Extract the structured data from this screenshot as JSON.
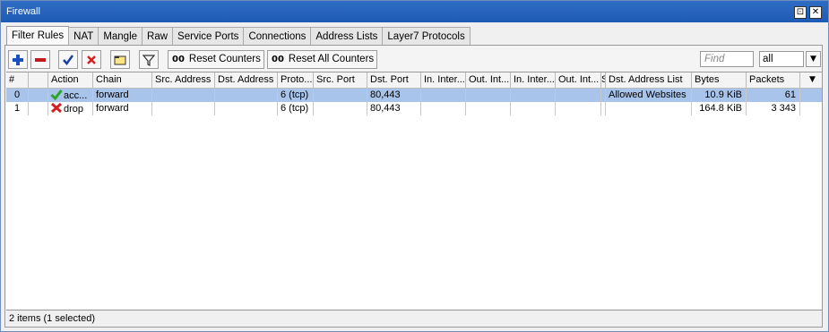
{
  "window": {
    "title": "Firewall",
    "restore_glyph": "⊡",
    "close_glyph": "✕"
  },
  "tabs": [
    {
      "label": "Filter Rules",
      "active": true
    },
    {
      "label": "NAT"
    },
    {
      "label": "Mangle"
    },
    {
      "label": "Raw"
    },
    {
      "label": "Service Ports"
    },
    {
      "label": "Connections"
    },
    {
      "label": "Address Lists"
    },
    {
      "label": "Layer7 Protocols"
    }
  ],
  "toolbar": {
    "add_icon": "plus-icon",
    "remove_icon": "minus-icon",
    "enable_icon": "check-icon",
    "disable_icon": "x-icon",
    "comment_icon": "note-icon",
    "filter_icon": "funnel-icon",
    "counter_prefix": "00",
    "reset_counters": "Reset Counters",
    "reset_all_counters": "Reset All Counters",
    "find_placeholder": "Find",
    "filter_value": "all"
  },
  "columns": [
    "#",
    "",
    "Action",
    "Chain",
    "Src. Address",
    "Dst. Address",
    "Proto...",
    "Src. Port",
    "Dst. Port",
    "In. Inter...",
    "Out. Int...",
    "In. Inter...",
    "Out. Int...",
    "S",
    "Dst. Address List",
    "Bytes",
    "Packets"
  ],
  "rows": [
    {
      "num": "0",
      "action": "acc...",
      "action_icon": "check-icon",
      "chain": "forward",
      "proto": "6 (tcp)",
      "dst_port": "80,443",
      "dst_addr_list": "Allowed Websites",
      "bytes": "10.9 KiB",
      "packets": "61",
      "selected": true
    },
    {
      "num": "1",
      "action": "drop",
      "action_icon": "x-icon",
      "chain": "forward",
      "proto": "6 (tcp)",
      "dst_port": "80,443",
      "dst_addr_list": "",
      "bytes": "164.8 KiB",
      "packets": "3 343",
      "selected": false
    }
  ],
  "status": "2 items (1 selected)",
  "colors": {
    "titlebar": "#2f6cc4",
    "selection": "#a8c4ea",
    "accept": "#2aa52a",
    "drop": "#d42020",
    "add": "#1a4fc0"
  }
}
